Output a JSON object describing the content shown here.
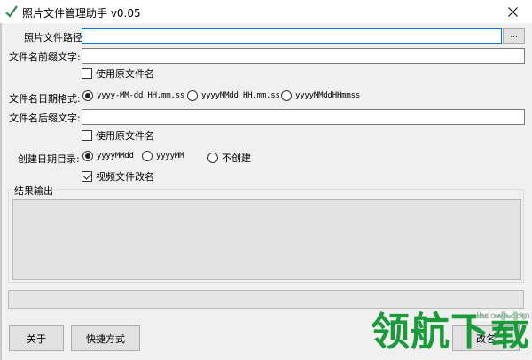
{
  "window": {
    "title": "照片文件管理助手 v0.05"
  },
  "path": {
    "label": "照片文件路径:",
    "value": "",
    "browse_label": "..."
  },
  "prefix": {
    "label": "文件名前缀文字:",
    "value": "",
    "use_original_label": "使用原文件名",
    "use_original_checked": false
  },
  "date_format": {
    "label": "文件名日期格式:",
    "options": [
      "yyyy-MM-dd HH.mm.ss",
      "yyyyMMdd HH.mm.ss",
      "yyyyMMddHHmmss"
    ],
    "selected": 0
  },
  "suffix": {
    "label": "文件名后缀文字:",
    "value": "",
    "use_original_label": "使用原文件名",
    "use_original_checked": false
  },
  "date_dir": {
    "label": "创建日期目录:",
    "options": [
      "yyyyMMdd",
      "yyyyMM",
      "不创建"
    ],
    "selected": 0
  },
  "video_rename": {
    "label": "视频文件改名",
    "checked": true
  },
  "output": {
    "label": "结果输出",
    "content": ""
  },
  "progress": {
    "value": 0
  },
  "buttons": {
    "about": "关于",
    "shortcut": "快捷方式",
    "rename": "改名"
  },
  "watermark": {
    "text": "领航下载",
    "url": "lhdown.com"
  }
}
